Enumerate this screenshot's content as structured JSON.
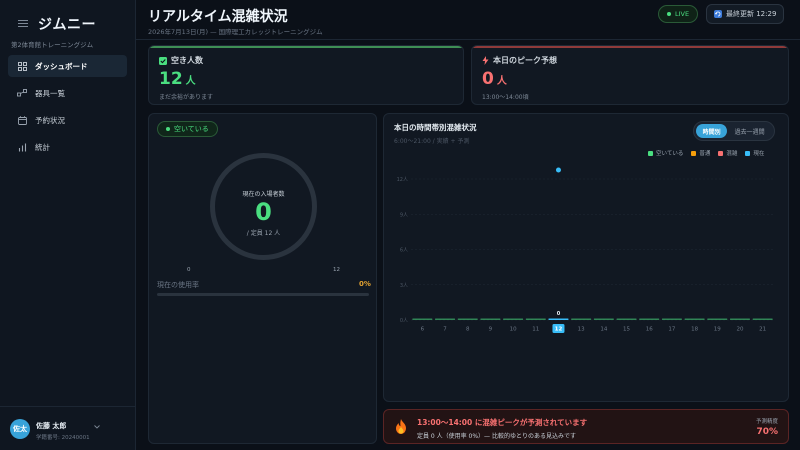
{
  "sidebar": {
    "brand": "ジムニー",
    "subtitle": "第2体育館トレーニングジム",
    "items": [
      {
        "label": "ダッシュボード",
        "icon": "dashboard-icon",
        "active": true
      },
      {
        "label": "器具一覧",
        "icon": "equipment-icon",
        "active": false
      },
      {
        "label": "予約状況",
        "icon": "calendar-icon",
        "active": false
      },
      {
        "label": "統計",
        "icon": "bar-chart-icon",
        "active": false
      }
    ],
    "user": {
      "avatar": "佐太",
      "name": "佐藤 太郎",
      "id": "学籍番号: 20240001"
    }
  },
  "header": {
    "title": "リアルタイム混雑状況",
    "subtitle": "2026年7月13日(月) — 国際理工カレッジトレーニングジム",
    "live_label": "LIVE",
    "update_label": "最終更新 12:29"
  },
  "cards": {
    "vacancy": {
      "label": "空き人数",
      "value": "12",
      "unit": "人",
      "note": "まだ余裕があります",
      "color": "#4ade80"
    },
    "peak": {
      "label": "本日のピーク予想",
      "value": "0",
      "unit": "人",
      "note": "13:00〜14:00頃",
      "color": "#f87171"
    }
  },
  "gauge": {
    "status": "空いている",
    "label": "現在の入場者数",
    "value": "0",
    "capacity": "/ 定員 12 人",
    "min": "0",
    "max": "12",
    "usage_label": "現在の使用率",
    "usage_value": "0%",
    "usage_fraction": 0
  },
  "chart": {
    "title": "本日の時間帯別混雑状況",
    "subtitle": "6:00〜21:00 / 実績 + 予測",
    "tabs": [
      "時間別",
      "過去一週間"
    ],
    "legend": [
      {
        "label": "空いている",
        "color": "#4ade80"
      },
      {
        "label": "普通",
        "color": "#f59e0b"
      },
      {
        "label": "混雑",
        "color": "#f87171"
      },
      {
        "label": "現在",
        "color": "#38bdf8"
      }
    ]
  },
  "chart_data": {
    "type": "bar",
    "categories": [
      "6",
      "7",
      "8",
      "9",
      "10",
      "11",
      "12",
      "13",
      "14",
      "15",
      "16",
      "17",
      "18",
      "19",
      "20",
      "21"
    ],
    "values": [
      0,
      0,
      0,
      0,
      0,
      0,
      0,
      0,
      0,
      0,
      0,
      0,
      0,
      0,
      0,
      0
    ],
    "current_hour": "12",
    "current_label": "0",
    "yticks": [
      "0人",
      "3人",
      "6人",
      "9人",
      "12人"
    ],
    "ylim": [
      0,
      12
    ],
    "xlabel": "",
    "ylabel": ""
  },
  "alert": {
    "title": "13:00〜14:00 に混雑ピークが予測されています",
    "sub": "定員 0 人（使用率 0%）— 比較的ゆとりのある見込みです",
    "prob_label": "予測精度",
    "prob": "70%"
  }
}
